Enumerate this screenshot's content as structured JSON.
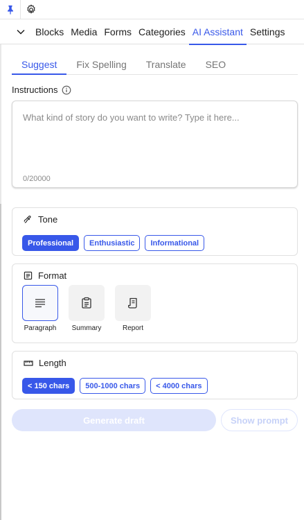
{
  "topbar": {
    "pin_icon": "pin-icon",
    "settings_icon": "gear-icon"
  },
  "nav": {
    "toggle_icon": "chevron-down-icon",
    "tabs": [
      "Blocks",
      "Media",
      "Forms",
      "Categories",
      "AI Assistant",
      "Settings"
    ],
    "active_tab": "AI Assistant"
  },
  "subtabs": [
    "Suggest",
    "Fix Spelling",
    "Translate",
    "SEO"
  ],
  "active_subtab": "Suggest",
  "instructions": {
    "label": "Instructions",
    "info_icon": "info-icon",
    "placeholder": "What kind of story do you want to write? Type it here...",
    "value": "",
    "counter": "0/20000"
  },
  "tone": {
    "title": "Tone",
    "icon": "tone-icon",
    "options": [
      "Professional",
      "Enthusiastic",
      "Informational"
    ],
    "selected": "Professional"
  },
  "format": {
    "title": "Format",
    "icon": "format-icon",
    "options": [
      {
        "label": "Paragraph",
        "icon": "paragraph-icon"
      },
      {
        "label": "Summary",
        "icon": "summary-icon"
      },
      {
        "label": "Report",
        "icon": "report-icon"
      }
    ],
    "selected": "Paragraph"
  },
  "length": {
    "title": "Length",
    "icon": "ruler-icon",
    "options": [
      "< 150 chars",
      "500-1000 chars",
      "< 4000 chars"
    ],
    "selected": "< 150 chars"
  },
  "actions": {
    "generate_label": "Generate draft",
    "show_prompt_label": "Show prompt"
  },
  "colors": {
    "accent": "#3858e9",
    "disabled": "#dfe5fc"
  }
}
